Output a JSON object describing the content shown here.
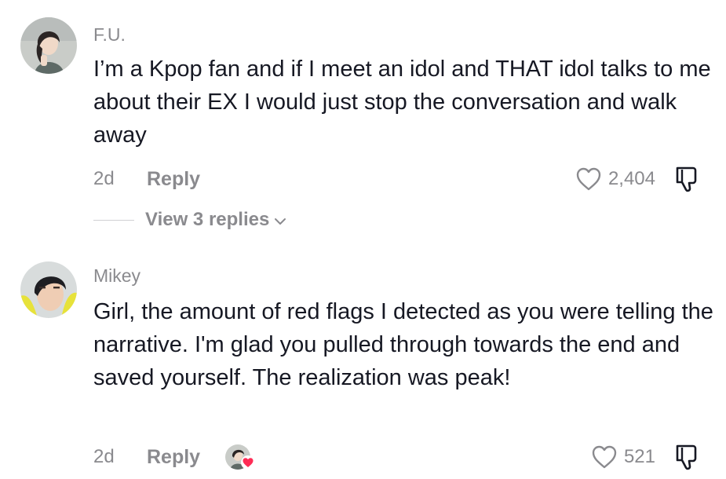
{
  "comments": [
    {
      "username": "F.U.",
      "text": "I’m a Kpop fan and if I meet an idol and THAT idol talks to me about their EX I would just stop the conversation and walk away",
      "date": "2d",
      "reply_label": "Reply",
      "likes": "2,404",
      "view_replies": "View 3 replies"
    },
    {
      "username": "Mikey",
      "text": "Girl, the amount of red flags I detected as you were telling the narrative. I'm glad you pulled through towards the end and saved yourself. The realization was peak!",
      "date": "2d",
      "reply_label": "Reply",
      "likes": "521",
      "liked_by_creator": true
    }
  ],
  "colors": {
    "text_primary": "#161823",
    "text_secondary": "#8a8a8e",
    "creator_heart": "#fe2c55"
  },
  "icons": {
    "like": "heart-outline-icon",
    "dislike": "thumbs-down-outline-icon",
    "expand": "chevron-down-icon",
    "creator_like": "creator-heart-icon"
  }
}
